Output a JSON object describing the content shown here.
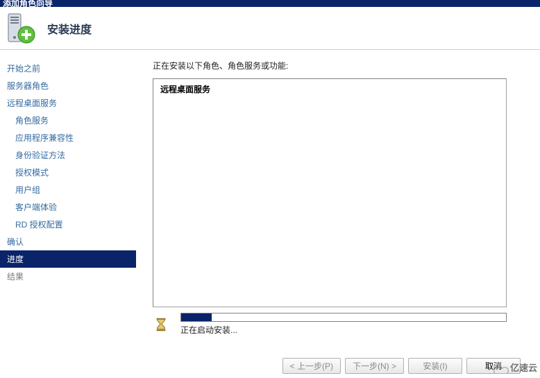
{
  "window": {
    "title": "添加角色向导"
  },
  "header": {
    "title": "安装进度"
  },
  "sidebar": {
    "items": [
      {
        "label": "开始之前",
        "cls": ""
      },
      {
        "label": "服务器角色",
        "cls": ""
      },
      {
        "label": "远程桌面服务",
        "cls": ""
      },
      {
        "label": "角色服务",
        "cls": "sub"
      },
      {
        "label": "应用程序兼容性",
        "cls": "sub"
      },
      {
        "label": "身份验证方法",
        "cls": "sub"
      },
      {
        "label": "授权模式",
        "cls": "sub"
      },
      {
        "label": "用户组",
        "cls": "sub"
      },
      {
        "label": "客户端体验",
        "cls": "sub"
      },
      {
        "label": "RD 授权配置",
        "cls": "sub"
      },
      {
        "label": "确认",
        "cls": ""
      },
      {
        "label": "进度",
        "cls": "selected"
      },
      {
        "label": "结果",
        "cls": "dim"
      }
    ]
  },
  "content": {
    "label": "正在安装以下角色、角色服务或功能:",
    "install_item": "远程桌面服务",
    "progress_text": "正在启动安装..."
  },
  "buttons": {
    "prev": "< 上一步(P)",
    "next": "下一步(N) >",
    "install": "安装(I)",
    "cancel": "取消"
  },
  "watermark": "亿速云"
}
